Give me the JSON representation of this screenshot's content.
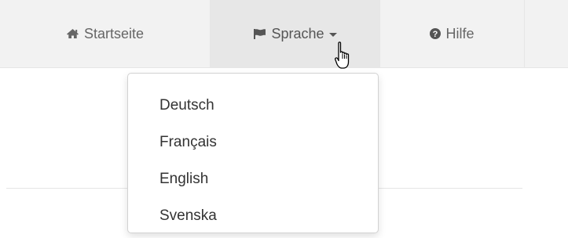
{
  "nav": {
    "home": {
      "label": "Startseite",
      "icon": "home-icon"
    },
    "language": {
      "label": "Sprache",
      "icon": "flag-icon"
    },
    "help": {
      "label": "Hilfe",
      "icon": "question-circle-icon"
    }
  },
  "language_menu": {
    "options": [
      "Deutsch",
      "Français",
      "English",
      "Svenska"
    ]
  }
}
